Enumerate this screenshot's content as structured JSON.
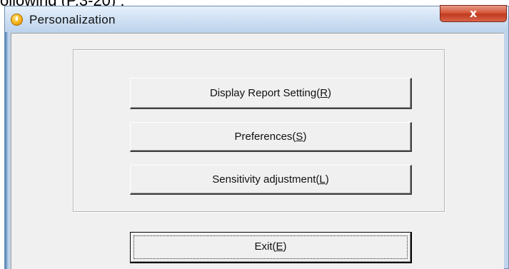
{
  "document": {
    "fragment_text": "ollowing (P.3-20) :"
  },
  "window": {
    "title": "Personalization",
    "icon": "warning-info-icon",
    "close_label": "x"
  },
  "buttons": {
    "display_report_setting": {
      "text": "Display Report Setting(",
      "accel": "R",
      "tail": ")"
    },
    "preferences": {
      "text": "Preferences(",
      "accel": "S",
      "tail": ")"
    },
    "sensitivity_adjustment": {
      "text": "Sensitivity adjustment(",
      "accel": "L",
      "tail": ")"
    },
    "exit": {
      "text": "Exit(",
      "accel": "E",
      "tail": ")"
    }
  },
  "colors": {
    "title_bar": "#d2e2f4",
    "close_button": "#c03a1f",
    "client_background": "#f0f0f0"
  }
}
